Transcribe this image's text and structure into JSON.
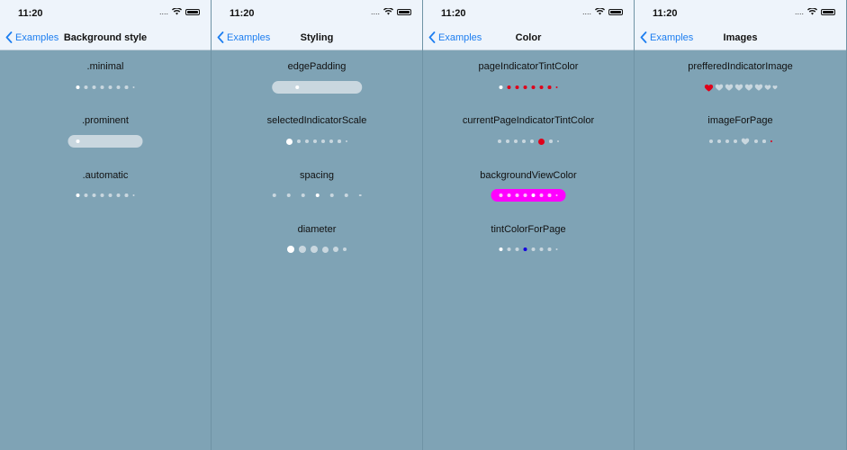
{
  "status": {
    "time": "11:20"
  },
  "nav": {
    "back_label": "Examples"
  },
  "colors": {
    "background": "#7fa3b5",
    "bar_background": "#eef4fb",
    "accent": "#1d7ef0",
    "indicator_red": "#e0001a",
    "indicator_blue": "#1200e0",
    "background_view_magenta": "#ff00ff"
  },
  "screens": [
    {
      "title": "Background style",
      "sections": [
        {
          "label": ".minimal",
          "style": "minimal",
          "pages": 8,
          "current": 0
        },
        {
          "label": ".prominent",
          "style": "prominent",
          "pages": 8,
          "current": 0
        },
        {
          "label": ".automatic",
          "style": "minimal",
          "pages": 8,
          "current": 0
        }
      ]
    },
    {
      "title": "Styling",
      "sections": [
        {
          "label": "edgePadding",
          "style": "prominent",
          "pages": 6,
          "current": 0
        },
        {
          "label": "selectedIndicatorScale",
          "style": "minimal",
          "pages": 8,
          "current": 0
        },
        {
          "label": "spacing",
          "style": "minimal",
          "pages": 7,
          "current": 3
        },
        {
          "label": "diameter",
          "style": "minimal",
          "pages": 6,
          "current": 0
        }
      ]
    },
    {
      "title": "Color",
      "sections": [
        {
          "label": "pageIndicatorTintColor",
          "style": "minimal",
          "pages": 8,
          "current": 0,
          "tint": "red"
        },
        {
          "label": "currentPageIndicatorTintColor",
          "style": "minimal",
          "pages": 8,
          "current": 5,
          "current_tint": "red"
        },
        {
          "label": "backgroundViewColor",
          "style": "magenta",
          "pages": 8,
          "current": 4
        },
        {
          "label": "tintColorForPage",
          "style": "minimal",
          "pages": 8,
          "current": 0,
          "special_page": 3,
          "special_tint": "blue"
        }
      ]
    },
    {
      "title": "Images",
      "sections": [
        {
          "label": "prefferedIndicatorImage",
          "style": "hearts",
          "pages": 8,
          "current": 0,
          "indicator_icon": "heart-icon"
        },
        {
          "label": "imageForPage",
          "style": "minimal",
          "pages": 8,
          "current": 4,
          "current_icon": "heart-icon",
          "special_page": 7,
          "special_tint": "red"
        }
      ]
    }
  ]
}
